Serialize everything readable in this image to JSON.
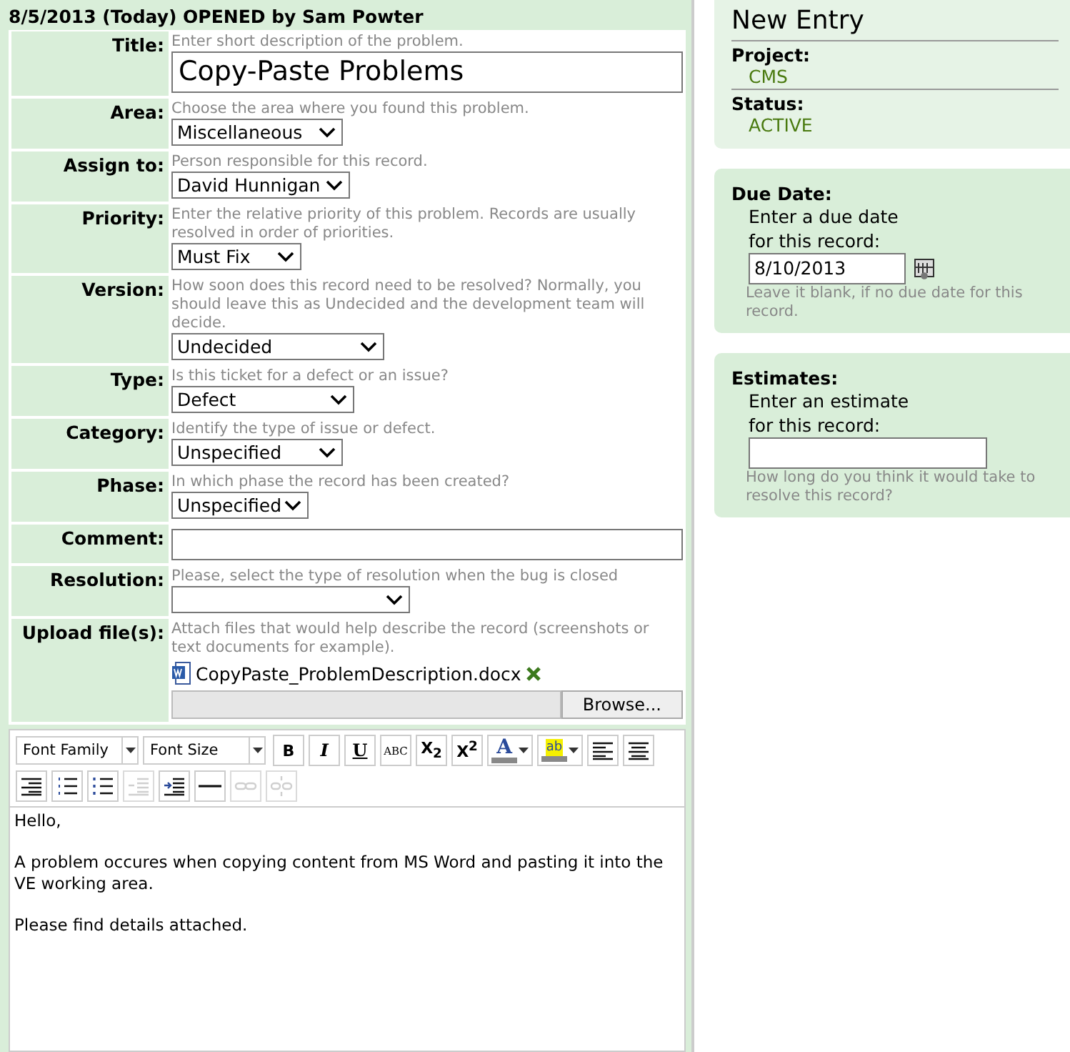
{
  "header": "8/5/2013 (Today) OPENED by Sam Powter",
  "fields": [
    {
      "label": "Title:",
      "hint": "Enter short description of the problem.",
      "kind": "title",
      "value": "Copy-Paste Problems"
    },
    {
      "label": "Area:",
      "hint": "Choose the area where you found this problem.",
      "kind": "select",
      "value": "Miscellaneous"
    },
    {
      "label": "Assign to:",
      "hint": "Person responsible for this record.",
      "kind": "select",
      "value": "David Hunnigan"
    },
    {
      "label": "Priority:",
      "hint": "Enter the relative priority of this problem. Records are usually resolved in order of priorities.",
      "kind": "select",
      "value": "Must Fix"
    },
    {
      "label": "Version:",
      "hint": "How soon does this record need to be resolved? Normally, you should leave this as Undecided and the development team will decide.",
      "kind": "select",
      "value": "Undecided"
    },
    {
      "label": "Type:",
      "hint": "Is this ticket for a defect or an issue?",
      "kind": "select",
      "value": "Defect"
    },
    {
      "label": "Category:",
      "hint": "Identify the type of issue or defect.",
      "kind": "select",
      "value": "Unspecified"
    },
    {
      "label": "Phase:",
      "hint": "In which phase the record has been created?",
      "kind": "select",
      "value": "Unspecified"
    },
    {
      "label": "Comment:",
      "kind": "text"
    },
    {
      "label": "Resolution:",
      "hint": "Please, select the type of resolution when the bug is closed",
      "kind": "select"
    },
    {
      "label": "Upload file(s):",
      "hint": "Attach files that would help describe the record (screenshots or text documents for example).",
      "kind": "file",
      "file": "CopyPaste_ProblemDescription.docx",
      "button": "Browse..."
    }
  ],
  "toolbar": [
    {
      "kind": "dropdown",
      "label": "Font Family"
    },
    {
      "kind": "dropdown",
      "label": "Font Size"
    },
    {
      "kind": "key",
      "label": "B"
    },
    {
      "kind": "key",
      "label": "I"
    },
    {
      "kind": "key",
      "label": "U"
    },
    {
      "kind": "key",
      "label": "ABC"
    },
    {
      "kind": "key",
      "label": "X$_{2}$"
    },
    {
      "kind": "key",
      "label": "X$^{2}$"
    },
    {
      "kind": "color",
      "label": "A"
    },
    {
      "kind": "highlight",
      "label": "ab"
    },
    {
      "kind": "icon",
      "disabled": false
    },
    {
      "kind": "icon",
      "disabled": false
    },
    {
      "kind": "icon",
      "disabled": false
    },
    {
      "kind": "icon",
      "disabled": false
    },
    {
      "kind": "icon",
      "disabled": false
    },
    {
      "kind": "icon",
      "disabled": true
    },
    {
      "kind": "icon",
      "disabled": false
    },
    {
      "kind": "icon",
      "disabled": false
    },
    {
      "kind": "icon",
      "disabled": true
    },
    {
      "kind": "icon",
      "disabled": true
    }
  ],
  "editor": [
    "Hello,",
    "A problem occures when copying content from MS Word and pasting it into the VE working area.",
    "Please find details attached."
  ],
  "summary": {
    "title": "New Entry",
    "items": [
      {
        "label": "Project:",
        "value": "CMS"
      },
      {
        "label": "Status:",
        "value": "ACTIVE"
      }
    ]
  },
  "due_date": {
    "title": "Due Date:",
    "prompt": "Enter a due date for this record:",
    "value": "8/10/2013",
    "note": "Leave it blank, if no due date for this record."
  },
  "estimates": {
    "title": "Estimates:",
    "prompt": "Enter an estimate for this record:",
    "note": "How long do you think it would take to resolve this record?"
  }
}
